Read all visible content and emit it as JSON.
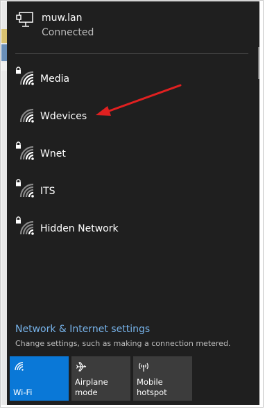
{
  "connected_network": {
    "name": "muw.lan",
    "status": "Connected"
  },
  "networks": [
    {
      "label": "Media",
      "secured": true
    },
    {
      "label": "Wdevices",
      "secured": false
    },
    {
      "label": "Wnet",
      "secured": true
    },
    {
      "label": "ITS",
      "secured": true
    },
    {
      "label": "Hidden Network",
      "secured": true
    }
  ],
  "settings": {
    "link": "Network & Internet settings",
    "description": "Change settings, such as making a connection metered."
  },
  "quick_actions": [
    {
      "label": "Wi-Fi",
      "icon": "wifi-icon",
      "active": true
    },
    {
      "label": "Airplane mode",
      "icon": "airplane-icon",
      "active": false
    },
    {
      "label": "Mobile hotspot",
      "icon": "hotspot-icon",
      "active": false
    }
  ],
  "colors": {
    "panel_bg": "#1f1f1f",
    "accent": "#0a78d7",
    "link": "#77b3ea",
    "annotation_arrow": "#e02020"
  }
}
